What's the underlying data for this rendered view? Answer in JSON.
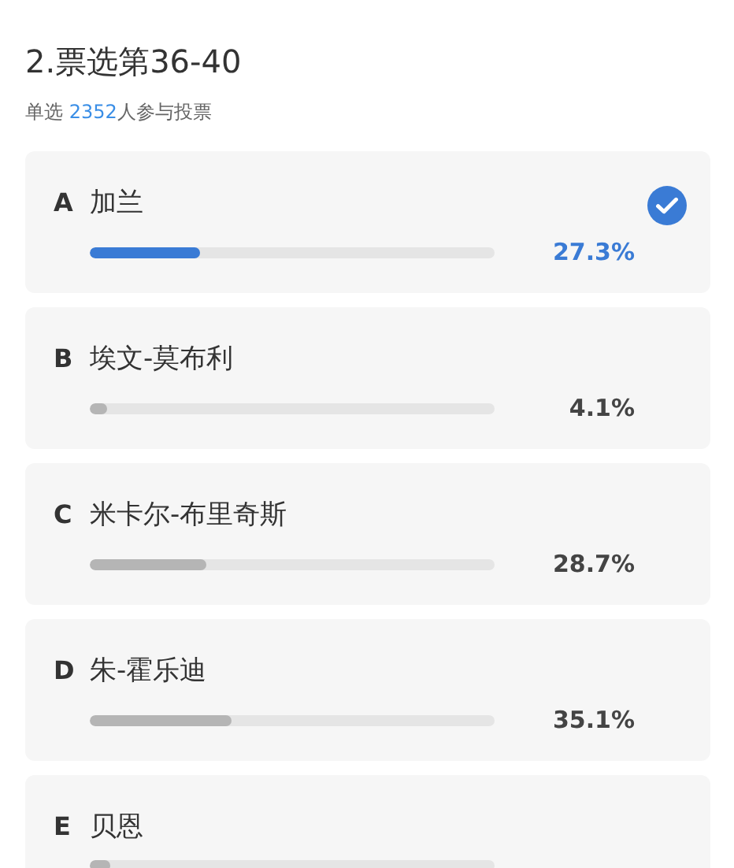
{
  "title": "2.票选第36-40",
  "subtitle": {
    "mode": "单选",
    "count": "2352",
    "suffix": "人参与投票"
  },
  "options": [
    {
      "letter": "A",
      "name": "加兰",
      "selected": true,
      "level": 0.273,
      "percent": "27.3%"
    },
    {
      "letter": "B",
      "name": "埃文-莫布利",
      "selected": false,
      "level": 0.041,
      "percent": "4.1%"
    },
    {
      "letter": "C",
      "name": "米卡尔-布里奇斯",
      "selected": false,
      "level": 0.287,
      "percent": "28.7%"
    },
    {
      "letter": "D",
      "name": "朱-霍乐迪",
      "selected": false,
      "level": 0.351,
      "percent": "35.1%"
    },
    {
      "letter": "E",
      "name": "贝恩",
      "selected": false,
      "level": 0.049
    }
  ]
}
